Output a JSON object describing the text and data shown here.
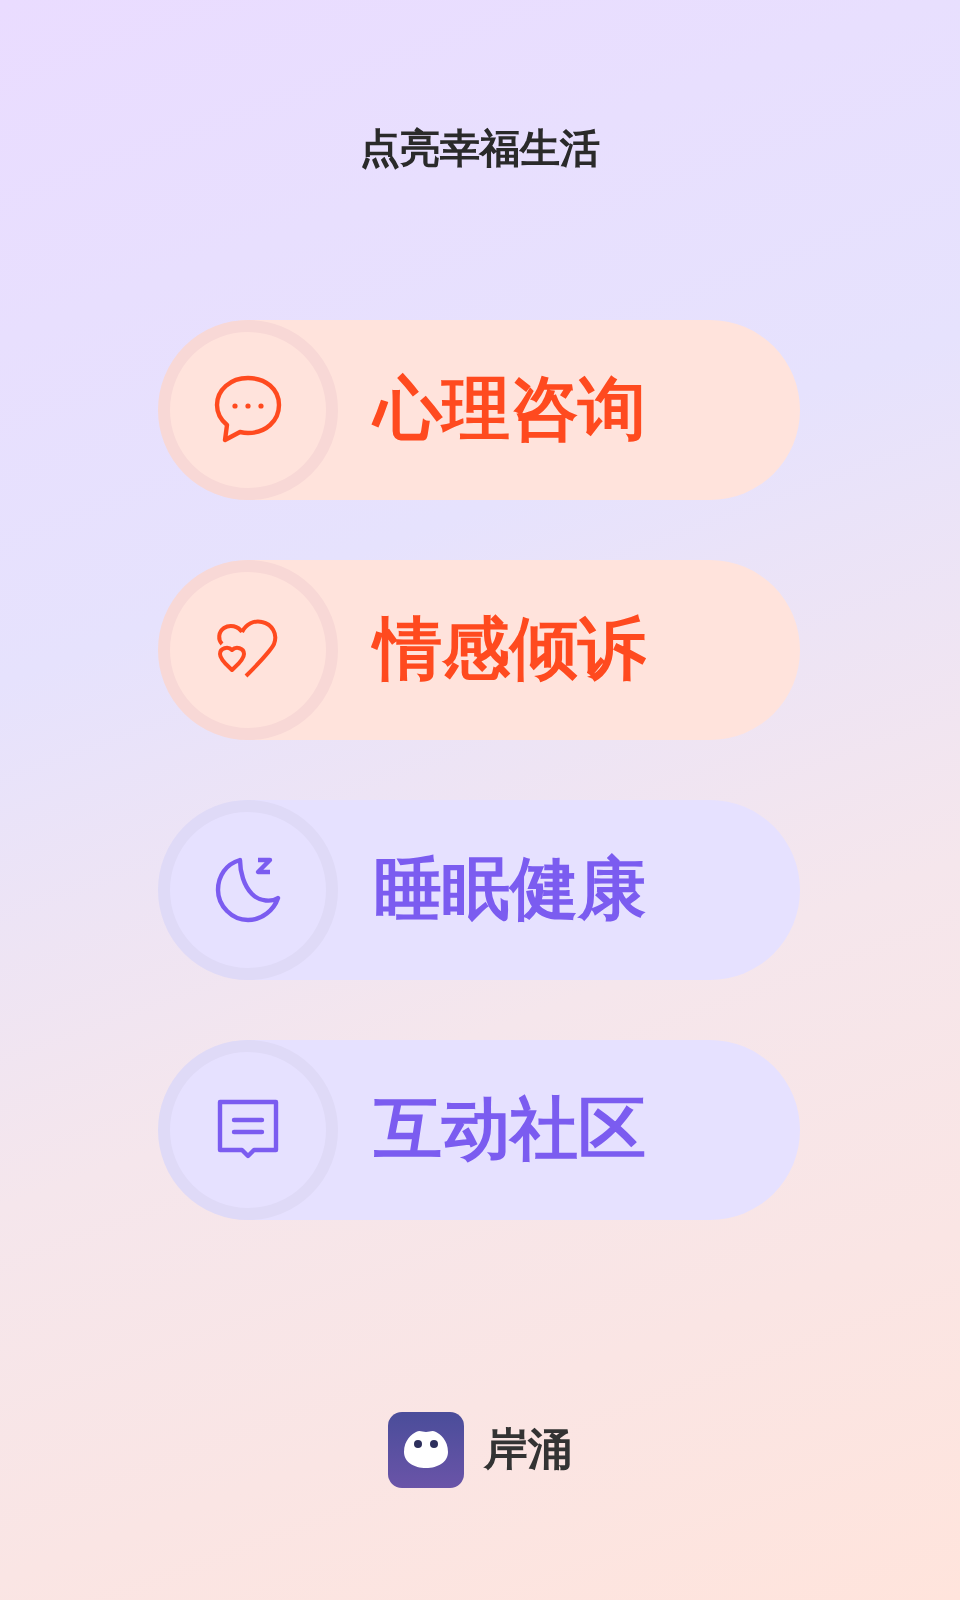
{
  "header": {
    "title": "点亮幸福生活"
  },
  "menu": [
    {
      "label": "心理咨询",
      "kind": "chat",
      "color": "#ff4a1f"
    },
    {
      "label": "情感倾诉",
      "kind": "heart",
      "color": "#ff4a1f"
    },
    {
      "label": "睡眠健康",
      "kind": "moon",
      "color": "#7b5cf0"
    },
    {
      "label": "互动社区",
      "kind": "message",
      "color": "#7b5cf0"
    }
  ],
  "footer": {
    "app_name": "岸涌"
  }
}
